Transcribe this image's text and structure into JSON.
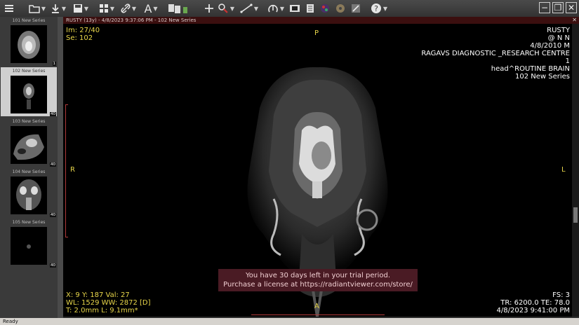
{
  "toolbar": {
    "icons": [
      "menu-icon",
      "open-folder-icon",
      "download-icon",
      "save-icon",
      "layout-grid-icon",
      "link-icon",
      "text-annotation-icon",
      "reports-icon",
      "crosshair-icon",
      "magnify-icon",
      "measure-icon",
      "rotate-icon",
      "film-icon",
      "scroll-icon",
      "3d-icon",
      "settings-icon",
      "tools-icon",
      "help-icon"
    ],
    "window_controls": [
      "minimize-button",
      "restore-button",
      "close-button"
    ]
  },
  "series": [
    {
      "label": "101 New Series",
      "count": "1"
    },
    {
      "label": "102 New Series",
      "count": "40"
    },
    {
      "label": "103 New Series",
      "count": "40"
    },
    {
      "label": "104 New Series",
      "count": "40"
    },
    {
      "label": "105 New Series",
      "count": "40"
    }
  ],
  "viewer": {
    "title": "RUSTY (13y) - 4/8/2023 9:37:06 PM - 102 New Series",
    "top_left": [
      "Im: 27/40",
      "Se: 102"
    ],
    "top_right": [
      "RUSTY",
      "@ N N",
      "4/8/2010 M",
      "RAGAVS DIAGNOSTIC _RESEARCH CENTRE",
      "1",
      "head^ROUTINE  BRAIN",
      "102 New Series"
    ],
    "bottom_left": [
      "X: 9 Y: 187 Val: 27",
      "WL: 1529 WW: 2872 [D]",
      "T: 2.0mm L: 9.1mm*"
    ],
    "bottom_right": [
      "FS: 3",
      "TR: 6200.0 TE: 78.0",
      "4/8/2023 9:41:00 PM"
    ],
    "orientation": {
      "top": "P",
      "bottom": "A",
      "left": "R",
      "right": "L"
    },
    "trial": [
      "You have 30 days left in your trial period.",
      "Purchase a license at https://radiantviewer.com/store/"
    ]
  },
  "status": {
    "text": "Ready"
  }
}
